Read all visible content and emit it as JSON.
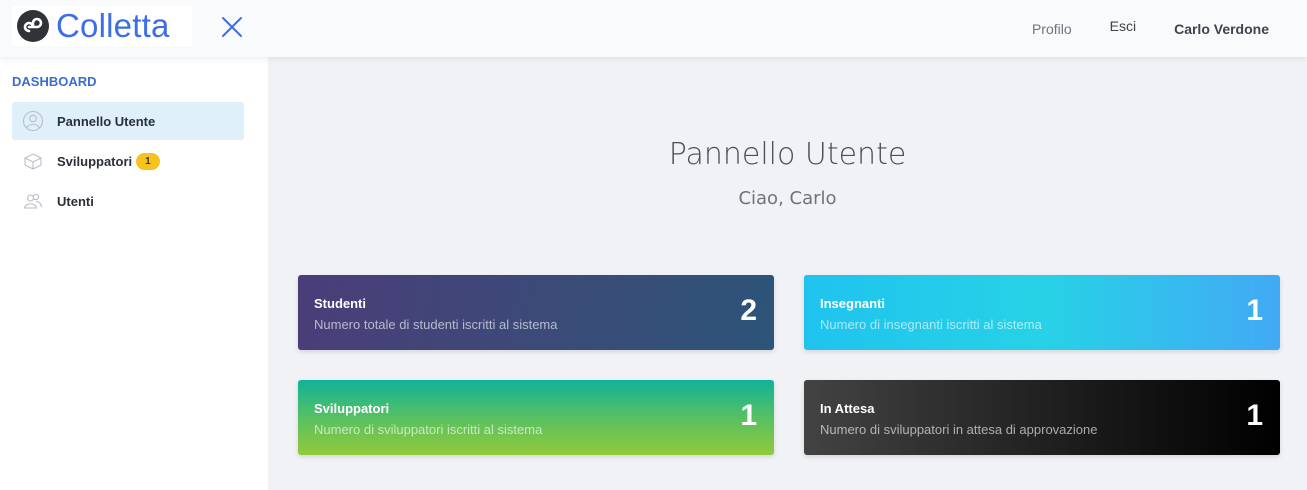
{
  "brand": {
    "name": "Colletta",
    "color": "#3c6ee6"
  },
  "header": {
    "profile_label": "Profilo",
    "logout_label": "Esci",
    "user_name": "Carlo Verdone"
  },
  "sidebar": {
    "heading": "DASHBOARD",
    "items": [
      {
        "label": "Pannello Utente",
        "icon": "user-circle-icon",
        "active": true
      },
      {
        "label": "Sviluppatori",
        "icon": "box-icon",
        "badge": "1"
      },
      {
        "label": "Utenti",
        "icon": "users-icon"
      }
    ]
  },
  "main": {
    "title": "Pannello Utente",
    "greeting": "Ciao, Carlo",
    "cards": [
      {
        "title": "Studenti",
        "description": "Numero totale di studenti iscritti al sistema",
        "value": "2"
      },
      {
        "title": "Insegnanti",
        "description": "Numero di insegnanti iscritti al sistema",
        "value": "1"
      },
      {
        "title": "Sviluppatori",
        "description": "Numero di sviluppatori iscritti al sistema",
        "value": "1"
      },
      {
        "title": "In Attesa",
        "description": "Numero di sviluppatori in attesa di approvazione",
        "value": "1"
      }
    ]
  }
}
